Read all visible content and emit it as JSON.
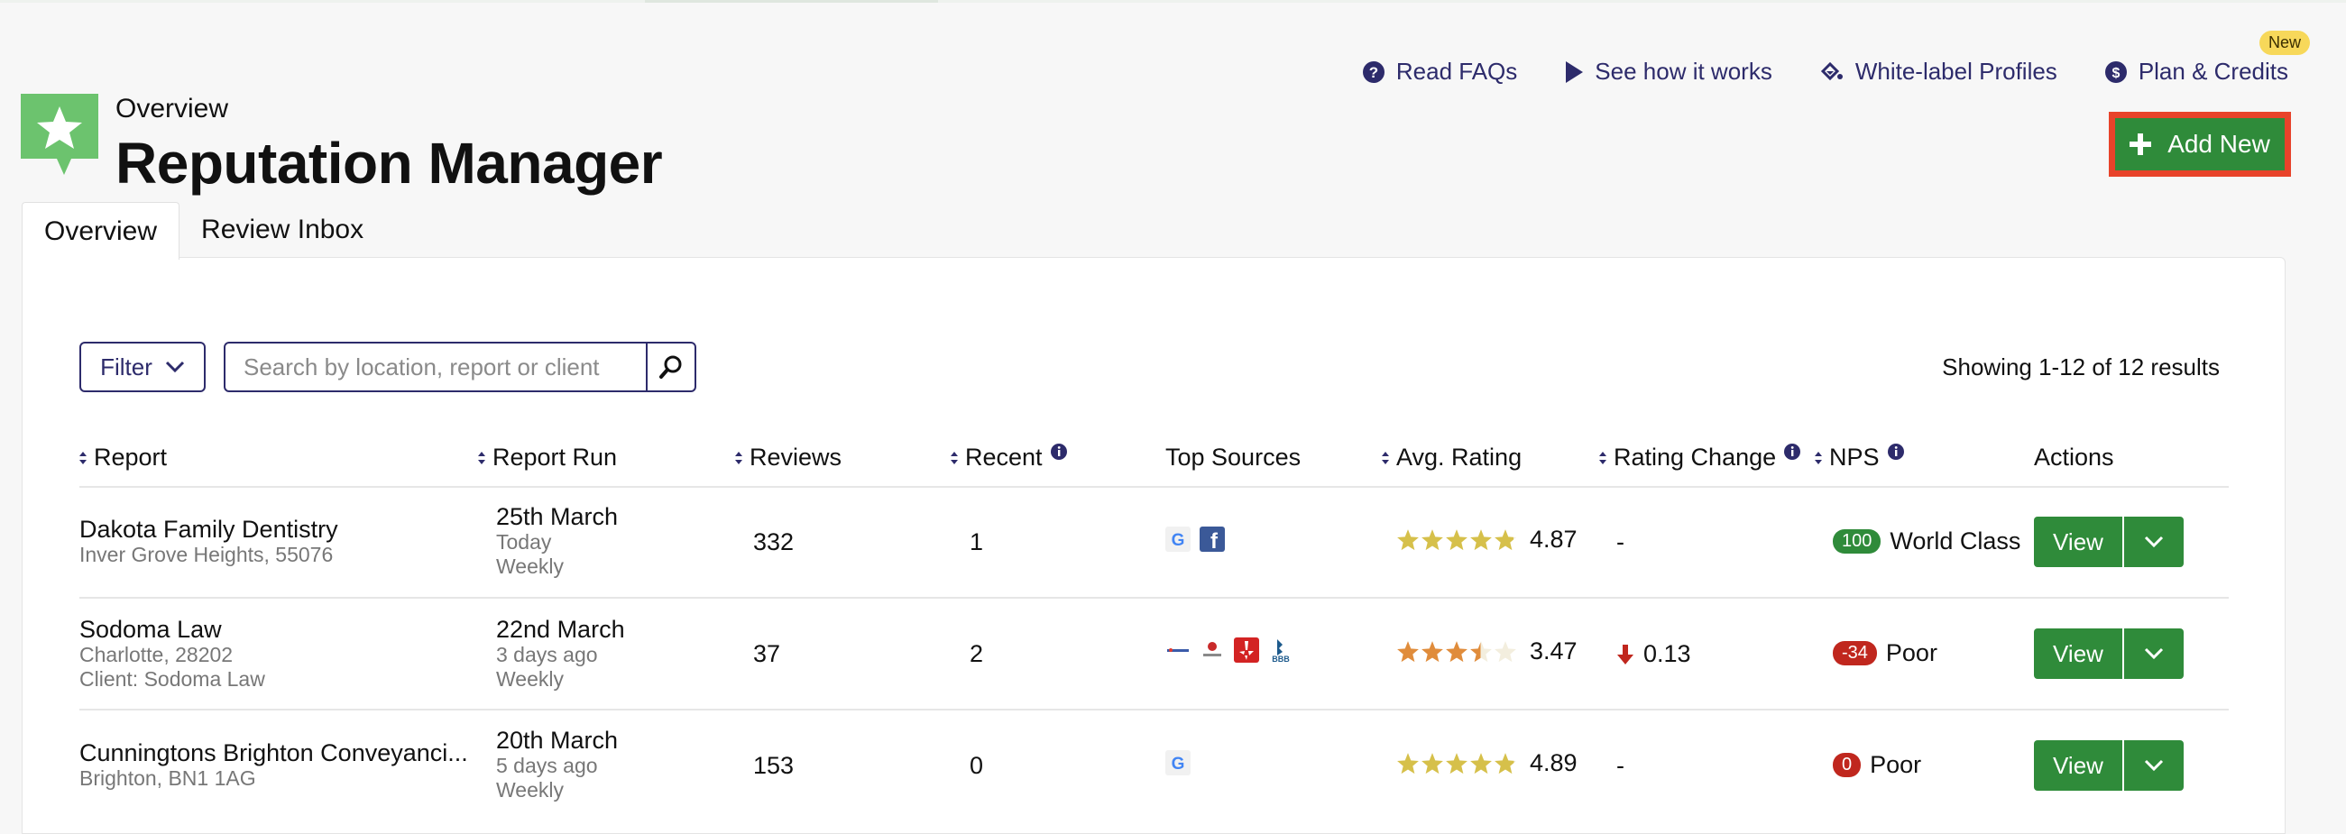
{
  "header": {
    "links": [
      {
        "label": "Read FAQs",
        "icon": "question-circle-icon"
      },
      {
        "label": "See how it works",
        "icon": "play-icon"
      },
      {
        "label": "White-label Profiles",
        "icon": "paint-bucket-icon"
      },
      {
        "label": "Plan & Credits",
        "icon": "dollar-circle-icon",
        "badge": "New"
      }
    ],
    "overline": "Overview",
    "title": "Reputation Manager",
    "add_new_label": "Add New"
  },
  "tabs": [
    {
      "label": "Overview",
      "active": true
    },
    {
      "label": "Review Inbox",
      "active": false
    }
  ],
  "toolbar": {
    "filter_label": "Filter",
    "search_placeholder": "Search by location, report or client",
    "results_text": "Showing 1-12 of 12 results"
  },
  "columns": [
    "Report",
    "Report Run",
    "Reviews",
    "Recent",
    "Top Sources",
    "Avg. Rating",
    "Rating Change",
    "NPS",
    "Actions"
  ],
  "rows": [
    {
      "name": "Dakota Family Dentistry",
      "location": "Inver Grove Heights, 55076",
      "client": "",
      "run_date": "25th March",
      "run_ago": "Today",
      "run_freq": "Weekly",
      "reviews": "332",
      "recent": "1",
      "sources": [
        "google-icon",
        "facebook-icon"
      ],
      "rating": "4.87",
      "rating_value": 4.87,
      "change": "-",
      "change_dir": "none",
      "nps": "100",
      "nps_label": "World Class",
      "nps_color": "#2f8b3a",
      "view_label": "View"
    },
    {
      "name": "Sodoma Law",
      "location": "Charlotte, 28202",
      "client": "Client: Sodoma Law",
      "run_date": "22nd March",
      "run_ago": "3 days ago",
      "run_freq": "Weekly",
      "reviews": "37",
      "recent": "2",
      "sources": [
        "lawyers-icon",
        "legal-icon",
        "yelp-icon",
        "bbb-icon"
      ],
      "rating": "3.47",
      "rating_value": 3.47,
      "change": "0.13",
      "change_dir": "down",
      "nps": "-34",
      "nps_label": "Poor",
      "nps_color": "#c0271e",
      "view_label": "View"
    },
    {
      "name": "Cunningtons Brighton Conveyanci...",
      "location": "Brighton, BN1 1AG",
      "client": "",
      "run_date": "20th March",
      "run_ago": "5 days ago",
      "run_freq": "Weekly",
      "reviews": "153",
      "recent": "0",
      "sources": [
        "google-icon"
      ],
      "rating": "4.89",
      "rating_value": 4.89,
      "change": "-",
      "change_dir": "none",
      "nps": "0",
      "nps_label": "Poor",
      "nps_color": "#c0271e",
      "view_label": "View"
    }
  ],
  "colors": {
    "brand_navy": "#2d2b6b",
    "action_green": "#2f8b3a",
    "highlight_red": "#e8432a",
    "star_gold": "#d6c04a",
    "star_orange": "#e08c3b"
  }
}
